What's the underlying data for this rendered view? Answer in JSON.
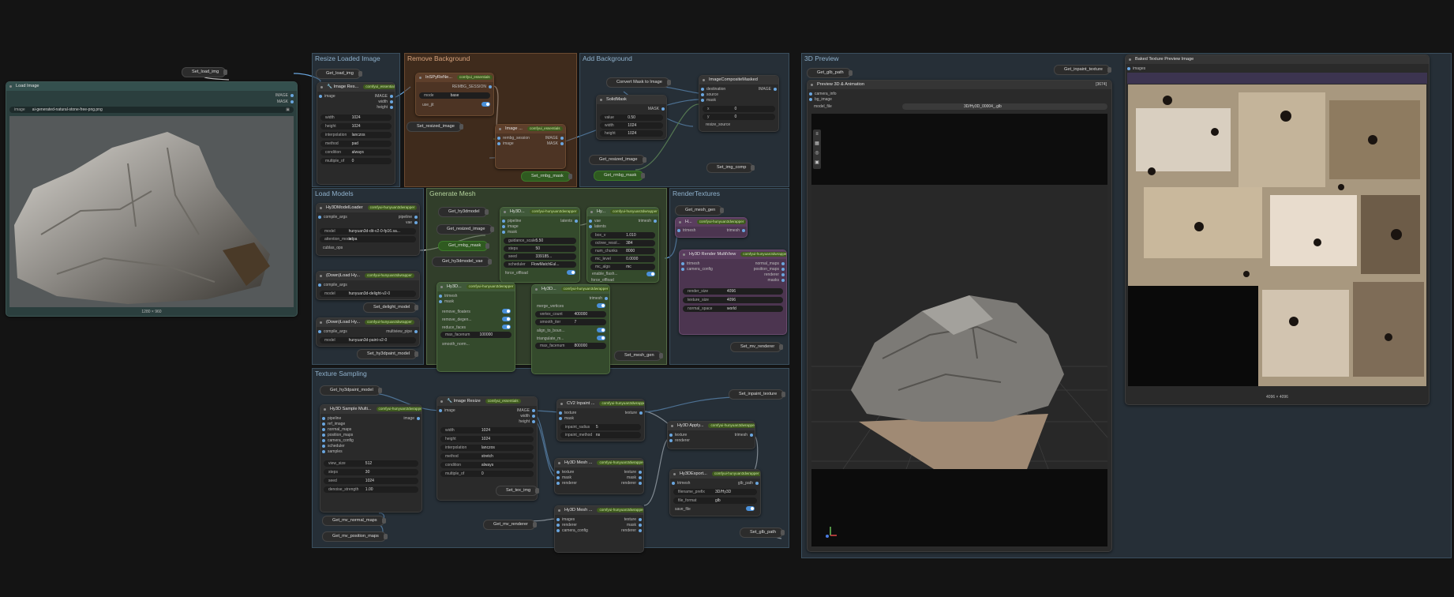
{
  "groups": {
    "resize": "Resize Loaded Image",
    "remove_bg": "Remove Background",
    "add_bg": "Add Background",
    "load_models": "Load Models",
    "gen_mesh": "Generate Mesh",
    "render_tex": "RenderTextures",
    "tex_sampling": "Texture Sampling",
    "preview3d": "3D Preview"
  },
  "pills": {
    "set_load_img_top": "Set_load_img",
    "get_load_img": "Get_load_img",
    "set_resized_image": "Set_resized_image",
    "convert_mask": "Convert Mask to Image",
    "get_resized_image": "Get_resized_image",
    "get_rmbg_mask": "Get_rmbg_mask",
    "set_rmbg_mask": "Set_rmbg_mask",
    "set_img_comp": "Set_img_comp",
    "get_hy3dmodel": "Get_hy3dmodel",
    "get_resized_image2": "Get_resized_image",
    "get_rmbg_mask2": "Get_rmbg_mask",
    "get_hy3dmodel_vae": "Get_hy3dmodel_vae",
    "set_delight_model": "Set_delight_model",
    "set_hy3dpaint_model": "Set_hy3dpaint_model",
    "set_mesh_gen": "Set_mesh_gen",
    "get_mesh_gen": "Get_mesh_gen",
    "set_mv_renderer": "Set_mv_renderer",
    "get_hy3dpaint_model": "Get_hy3dpaint_model",
    "get_mv_normal_maps": "Get_mv_normal_maps",
    "get_mv_position_maps": "Get_mv_position_maps",
    "set_tex_img": "Set_tex_img",
    "get_mv_renderer": "Get_mv_renderer",
    "set_inpaint_texture": "Set_inpaint_texture",
    "set_glb_path": "Set_glb_path",
    "get_glb_path": "Get_glb_path",
    "get_inpaint_texture": "Get_inpaint_texture"
  },
  "load_image": {
    "title": "Load Image",
    "out_image": "IMAGE",
    "out_mask": "MASK",
    "image_label": "image",
    "image_value": "ai-generated-natural-stone-free-png.png",
    "caption": "1280 × 960"
  },
  "image_resize": {
    "title": "🔧 Image Res...",
    "badge": "comfyui_essentials",
    "in_image": "image",
    "out_image": "IMAGE",
    "out_width": "width",
    "out_height": "height",
    "widgets": [
      {
        "k": "width",
        "v": "1024"
      },
      {
        "k": "height",
        "v": "1024"
      },
      {
        "k": "interpolation",
        "v": "lanczos"
      },
      {
        "k": "method",
        "v": "pad"
      },
      {
        "k": "condition",
        "v": "always"
      },
      {
        "k": "multiple_of",
        "v": "0"
      }
    ]
  },
  "inspyrenet": {
    "title": "InSPyReNe...",
    "badge": "comfyui_essentials",
    "out": "REMBG_SESSION",
    "mode_k": "mode",
    "mode_v": "base",
    "usejit": "use_jit"
  },
  "image_remove_bg": {
    "title": "Image ...",
    "badge": "comfyui_essentials",
    "in1": "rembg_session",
    "in2": "image",
    "out1": "IMAGE",
    "out2": "MASK"
  },
  "solidmask": {
    "title": "SolidMask",
    "out": "MASK",
    "widgets": [
      {
        "k": "value",
        "v": "0.50"
      },
      {
        "k": "width",
        "v": "1024"
      },
      {
        "k": "height",
        "v": "1024"
      }
    ]
  },
  "composite": {
    "title": "ImageCompositeMasked",
    "in1": "destination",
    "in2": "source",
    "in3": "mask",
    "out": "IMAGE",
    "widgets": [
      {
        "k": "x",
        "v": "0"
      },
      {
        "k": "y",
        "v": "0"
      },
      {
        "k": "resize_source",
        "v": ""
      }
    ]
  },
  "model_loader": {
    "title": "Hy3DModelLoader",
    "badge": "comfyui-hunyuan3dwrapper",
    "in1": "compile_args",
    "out1": "pipeline",
    "out2": "vae",
    "model_k": "model",
    "model_v": "hunyuan3d-dit-v2-0-fp16.sa...",
    "attn_k": "attention_mode",
    "attn_v": "sdpa",
    "cublas": "cublas_ops"
  },
  "delight_loader": {
    "title": "(Down)Load Hy...",
    "badge": "comfyui-hunyuan3dwrapper",
    "in1": "compile_args",
    "model_k": "model",
    "model_v": "hunyuan3d-delight-v2-0"
  },
  "paint_loader": {
    "title": "(Down)Load Hy...",
    "badge": "comfyui-hunyuan3dwrapper",
    "in1": "compile_args",
    "out1": "multiview_pipe",
    "model_k": "model",
    "model_v": "hunyuan3d-paint-v2-0"
  },
  "hy3d_generate": {
    "title": "Hy3D...",
    "badge": "comfyui-hunyuan3dwrapper",
    "in": [
      "pipeline",
      "image",
      "mask"
    ],
    "out": "latents",
    "widgets": [
      {
        "k": "guidance_scale",
        "v": "5.50"
      },
      {
        "k": "steps",
        "v": "50"
      },
      {
        "k": "seed",
        "v": "339185..."
      },
      {
        "k": "scheduler",
        "v": "FlowMatchEul..."
      },
      {
        "k": "force_offload",
        "v": ""
      }
    ]
  },
  "hy3d_vae": {
    "title": "Hy...",
    "badge": "comfyui-hunyuan3dwrapper",
    "in": [
      "vae",
      "latents"
    ],
    "out": "trimesh",
    "widgets": [
      {
        "k": "box_v",
        "v": "1.010"
      },
      {
        "k": "octree_resol...",
        "v": "384"
      },
      {
        "k": "num_chunks",
        "v": "8000"
      },
      {
        "k": "mc_level",
        "v": "0.0000"
      },
      {
        "k": "mc_algo",
        "v": "mc"
      },
      {
        "k": "enable_flash...",
        "v": ""
      },
      {
        "k": "force_offload",
        "v": ""
      }
    ]
  },
  "hy3d_post": {
    "title": "Hy3D...",
    "badge": "comfyui-hunyuan3dwrapper",
    "in": [
      "trimesh",
      "mask"
    ],
    "widgets": [
      {
        "k": "remove_floaters",
        "v": ""
      },
      {
        "k": "remove_degen...",
        "v": ""
      },
      {
        "k": "reduce_faces",
        "v": ""
      },
      {
        "k": "max_facenum",
        "v": "100000"
      },
      {
        "k": "smooth_norm...",
        "v": ""
      }
    ]
  },
  "hy3d_postprocess2": {
    "title": "Hy3D...",
    "badge": "comfyui-hunyuan3dwrapper",
    "out": "trimesh",
    "widgets": [
      {
        "k": "merge_vertices",
        "v": ""
      },
      {
        "k": "vertex_count",
        "v": "400000"
      },
      {
        "k": "smooth_iter",
        "v": "7"
      },
      {
        "k": "align_to_boun...",
        "v": ""
      },
      {
        "k": "triangulate_m...",
        "v": ""
      },
      {
        "k": "max_facenum",
        "v": "800000"
      }
    ]
  },
  "hy3d_mesh_uv": {
    "title": "H...",
    "badge": "comfyui-hunyuan3dwrapper",
    "in": "trimesh",
    "out": "trimesh"
  },
  "render_mv": {
    "title": "Hy3D Render MultiView",
    "badge": "comfyui-hunyuan3dwrapper",
    "in": [
      "trimesh",
      "camera_config"
    ],
    "out": [
      "normal_maps",
      "position_maps",
      "renderer",
      "masks"
    ],
    "widgets": [
      {
        "k": "render_size",
        "v": "4096"
      },
      {
        "k": "texture_size",
        "v": "4096"
      },
      {
        "k": "normal_space",
        "v": "world"
      }
    ]
  },
  "sample_mv": {
    "title": "Hy3D Sample Multi...",
    "badge": "comfyui-hunyuan3dwrapper",
    "in": [
      "pipeline",
      "ref_image",
      "normal_maps",
      "position_maps",
      "camera_config",
      "scheduler",
      "samples"
    ],
    "out": "image",
    "widgets": [
      {
        "k": "view_size",
        "v": "512"
      },
      {
        "k": "steps",
        "v": "30"
      },
      {
        "k": "seed",
        "v": "1024"
      },
      {
        "k": "denoise_strength",
        "v": "1.00"
      }
    ]
  },
  "image_resize2": {
    "title": "🔧 Image Resize",
    "badge": "comfyui_essentials",
    "in": "image",
    "out": [
      "IMAGE",
      "width",
      "height"
    ],
    "widgets": [
      {
        "k": "width",
        "v": "1024"
      },
      {
        "k": "height",
        "v": "1024"
      },
      {
        "k": "interpolation",
        "v": "lanczos"
      },
      {
        "k": "method",
        "v": "stretch"
      },
      {
        "k": "condition",
        "v": "always"
      },
      {
        "k": "multiple_of",
        "v": "0"
      }
    ]
  },
  "cv2_inpaint": {
    "title": "CV2 Inpaint ...",
    "badge": "comfyui-hunyuan3dwrapper",
    "in": [
      "texture",
      "mask"
    ],
    "out": "texture",
    "widgets": [
      {
        "k": "inpaint_radius",
        "v": "5"
      },
      {
        "k": "inpaint_method",
        "v": "ns"
      }
    ]
  },
  "mesh_uv_wrap": {
    "title": "Hy3D Mesh ...",
    "badge": "comfyui-hunyuan3dwrapper",
    "in": [
      "texture",
      "mask",
      "renderer"
    ],
    "out": [
      "texture",
      "mask",
      "renderer"
    ]
  },
  "bake_mv": {
    "title": "Hy3D Mesh ...",
    "badge": "comfyui-hunyuan3dwrapper",
    "in": [
      "images",
      "renderer",
      "camera_config"
    ],
    "out": [
      "texture",
      "mask",
      "renderer"
    ]
  },
  "apply_texture": {
    "title": "Hy3D Apply...",
    "badge": "comfyui-hunyuan3dwrapper",
    "in": [
      "texture",
      "renderer"
    ],
    "out": "trimesh"
  },
  "exporter": {
    "title": "Hy3DExport...",
    "badge": "comfyui-hunyuan3dwrapper",
    "in": "trimesh",
    "out": "glb_path",
    "widgets": [
      {
        "k": "filename_prefix",
        "v": "3D/Hy3D"
      },
      {
        "k": "file_format",
        "v": "glb"
      },
      {
        "k": "save_file",
        "v": ""
      }
    ]
  },
  "preview": {
    "title": "Preview 3D & Animation",
    "badge": "[3674]",
    "in": [
      "camera_info",
      "bg_image"
    ],
    "model_file_k": "model_file",
    "model_file_v": "3D/Hy3D_00004_.glb"
  },
  "baked_preview": {
    "title": "Baked Texture Preview Image",
    "in": "images",
    "caption": "4096 × 4096"
  },
  "colors": {
    "bg": "#141414",
    "group_blue": "#344654",
    "group_orange": "#5a3b25",
    "group_green": "#3f5436",
    "node_purple": "#5a3d5e",
    "link_blue": "#6aa6df",
    "link_green": "#7ab34f"
  }
}
